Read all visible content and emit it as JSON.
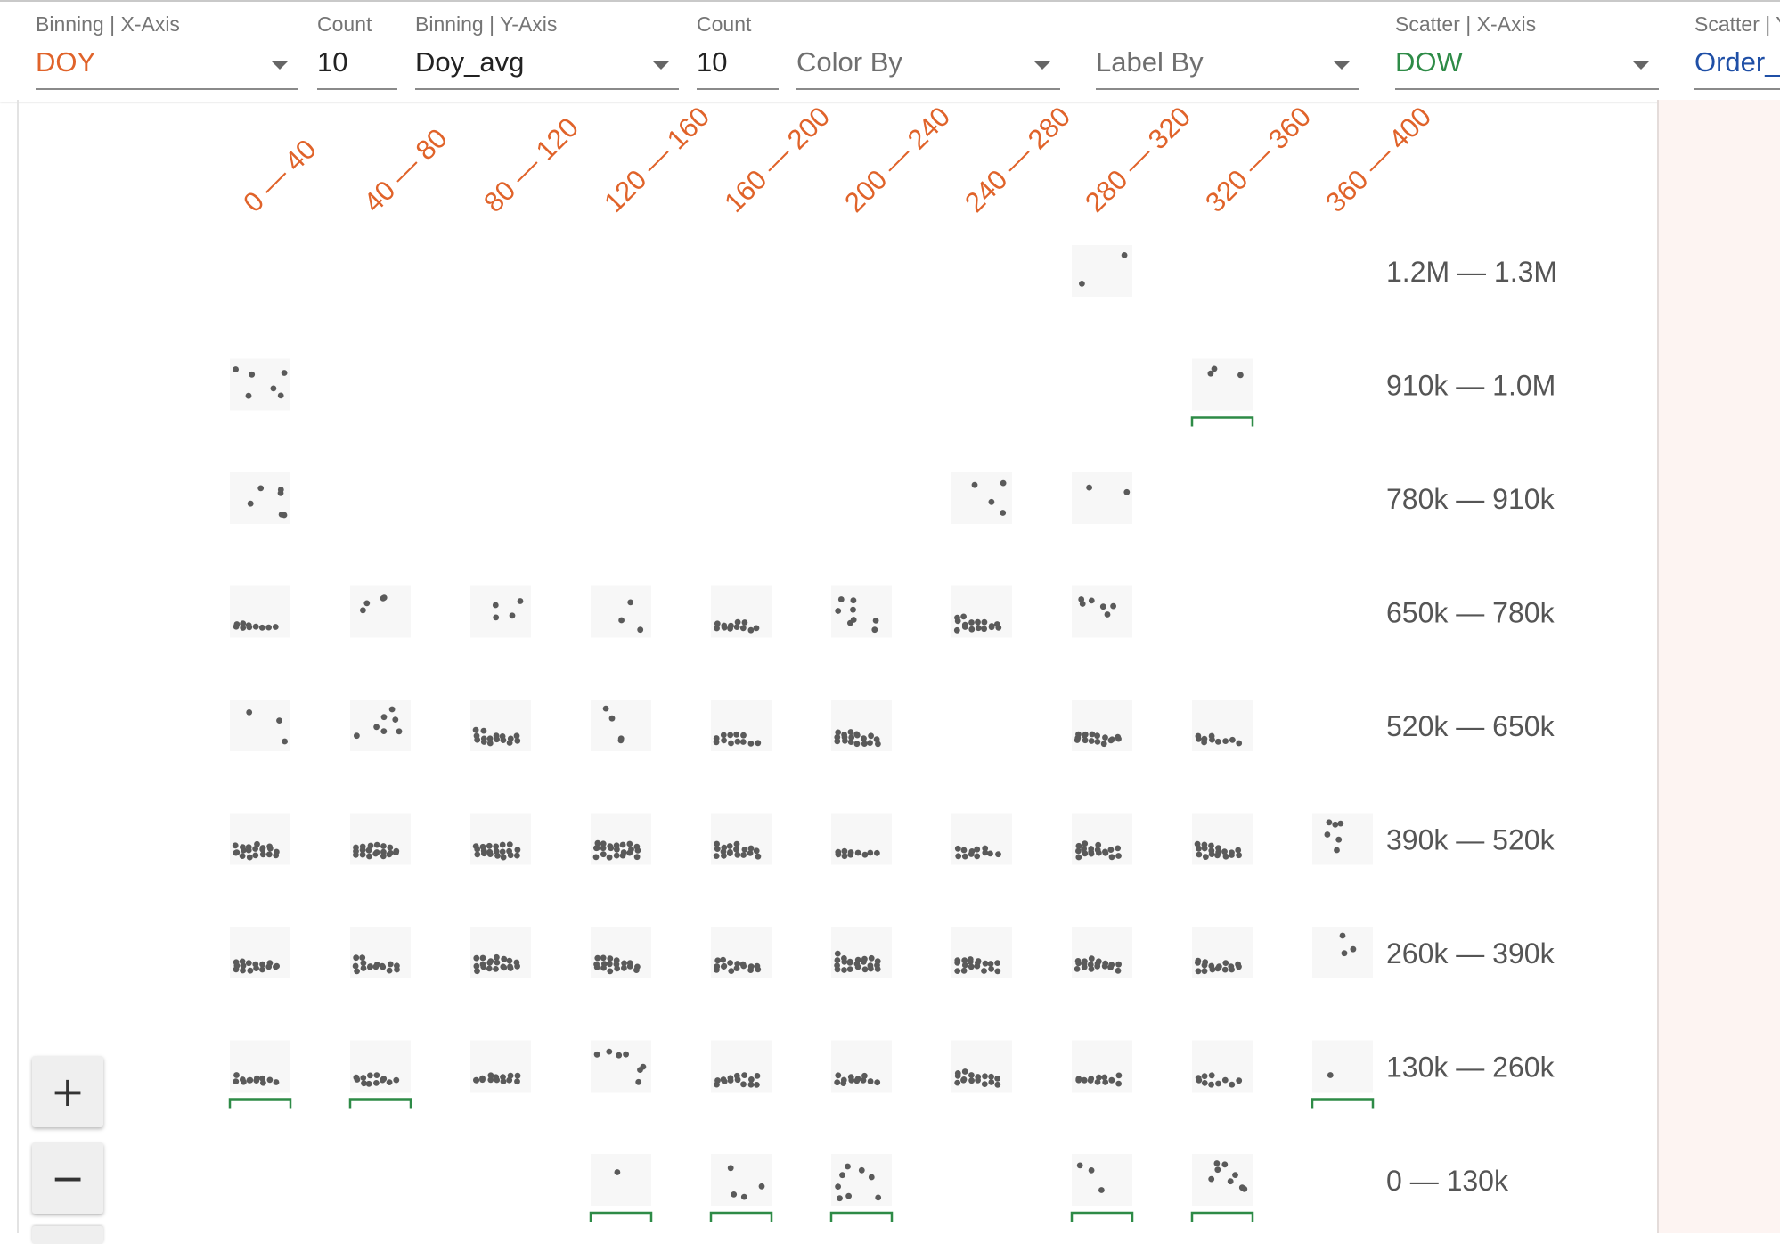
{
  "controls": {
    "binning_x": {
      "label": "Binning | X-Axis",
      "value": "DOY"
    },
    "count_x": {
      "label": "Count",
      "value": "10"
    },
    "binning_y": {
      "label": "Binning | Y-Axis",
      "value": "Doy_avg"
    },
    "count_y": {
      "label": "Count",
      "value": "10"
    },
    "color_by": {
      "placeholder": "Color By"
    },
    "label_by": {
      "placeholder": "Label By"
    },
    "scatter_x": {
      "label": "Scatter | X-Axis",
      "value": "DOW"
    },
    "scatter_y": {
      "label": "Scatter | Y",
      "value": "Order_"
    }
  },
  "colors": {
    "binning_x_value": "#e0632a",
    "scatter_x_value": "#2e8b47",
    "scatter_y_value": "#1f4fa6",
    "column_label": "#e0632a",
    "row_label": "#555555",
    "cell_background": "#f7f7f7",
    "dot": "#5a5a5a",
    "bracket": "#2e8b47"
  },
  "zoom": {
    "in_label": "+",
    "out_label": "−"
  },
  "chart_data": {
    "type": "scatter",
    "columns": [
      "0 — 40",
      "40 — 80",
      "80 — 120",
      "120 — 160",
      "160 — 200",
      "200 — 240",
      "240 — 280",
      "280 — 320",
      "320 — 360",
      "360 — 400"
    ],
    "rows": [
      "1.2M — 1.3M",
      "910k — 1.0M",
      "780k — 910k",
      "650k — 780k",
      "520k — 650k",
      "390k — 520k",
      "260k — 390k",
      "130k — 260k",
      "0 — 130k"
    ],
    "cells": [
      {
        "row": 0,
        "col": 7,
        "density": 2,
        "bracket": false
      },
      {
        "row": 1,
        "col": 0,
        "density": 6,
        "bracket": false
      },
      {
        "row": 1,
        "col": 8,
        "density": 3,
        "bracket": true
      },
      {
        "row": 2,
        "col": 0,
        "density": 6,
        "bracket": false
      },
      {
        "row": 2,
        "col": 6,
        "density": 4,
        "bracket": false
      },
      {
        "row": 2,
        "col": 7,
        "density": 2,
        "bracket": false
      },
      {
        "row": 3,
        "col": 0,
        "density": 10,
        "bracket": false
      },
      {
        "row": 3,
        "col": 1,
        "density": 4,
        "bracket": false
      },
      {
        "row": 3,
        "col": 2,
        "density": 4,
        "bracket": false
      },
      {
        "row": 3,
        "col": 3,
        "density": 3,
        "bracket": false
      },
      {
        "row": 3,
        "col": 4,
        "density": 12,
        "bracket": false
      },
      {
        "row": 3,
        "col": 5,
        "density": 8,
        "bracket": false
      },
      {
        "row": 3,
        "col": 6,
        "density": 16,
        "bracket": false
      },
      {
        "row": 3,
        "col": 7,
        "density": 6,
        "bracket": false
      },
      {
        "row": 4,
        "col": 0,
        "density": 3,
        "bracket": false
      },
      {
        "row": 4,
        "col": 1,
        "density": 7,
        "bracket": false
      },
      {
        "row": 4,
        "col": 2,
        "density": 16,
        "bracket": false
      },
      {
        "row": 4,
        "col": 3,
        "density": 4,
        "bracket": false
      },
      {
        "row": 4,
        "col": 4,
        "density": 12,
        "bracket": false
      },
      {
        "row": 4,
        "col": 5,
        "density": 18,
        "bracket": false
      },
      {
        "row": 4,
        "col": 7,
        "density": 16,
        "bracket": false
      },
      {
        "row": 4,
        "col": 8,
        "density": 10,
        "bracket": false
      },
      {
        "row": 5,
        "col": 0,
        "density": 20,
        "bracket": false
      },
      {
        "row": 5,
        "col": 1,
        "density": 20,
        "bracket": false
      },
      {
        "row": 5,
        "col": 2,
        "density": 20,
        "bracket": false
      },
      {
        "row": 5,
        "col": 3,
        "density": 22,
        "bracket": false
      },
      {
        "row": 5,
        "col": 4,
        "density": 18,
        "bracket": false
      },
      {
        "row": 5,
        "col": 5,
        "density": 10,
        "bracket": false
      },
      {
        "row": 5,
        "col": 6,
        "density": 12,
        "bracket": false
      },
      {
        "row": 5,
        "col": 7,
        "density": 18,
        "bracket": false
      },
      {
        "row": 5,
        "col": 8,
        "density": 18,
        "bracket": false
      },
      {
        "row": 5,
        "col": 9,
        "density": 6,
        "bracket": false
      },
      {
        "row": 6,
        "col": 0,
        "density": 16,
        "bracket": false
      },
      {
        "row": 6,
        "col": 1,
        "density": 16,
        "bracket": false
      },
      {
        "row": 6,
        "col": 2,
        "density": 20,
        "bracket": false
      },
      {
        "row": 6,
        "col": 3,
        "density": 18,
        "bracket": false
      },
      {
        "row": 6,
        "col": 4,
        "density": 16,
        "bracket": false
      },
      {
        "row": 6,
        "col": 5,
        "density": 22,
        "bracket": false
      },
      {
        "row": 6,
        "col": 6,
        "density": 18,
        "bracket": false
      },
      {
        "row": 6,
        "col": 7,
        "density": 18,
        "bracket": false
      },
      {
        "row": 6,
        "col": 8,
        "density": 16,
        "bracket": false
      },
      {
        "row": 6,
        "col": 9,
        "density": 3,
        "bracket": false
      },
      {
        "row": 7,
        "col": 0,
        "density": 12,
        "bracket": true
      },
      {
        "row": 7,
        "col": 1,
        "density": 12,
        "bracket": true
      },
      {
        "row": 7,
        "col": 2,
        "density": 14,
        "bracket": false
      },
      {
        "row": 7,
        "col": 3,
        "density": 7,
        "bracket": false
      },
      {
        "row": 7,
        "col": 4,
        "density": 14,
        "bracket": false
      },
      {
        "row": 7,
        "col": 5,
        "density": 12,
        "bracket": false
      },
      {
        "row": 7,
        "col": 6,
        "density": 16,
        "bracket": false
      },
      {
        "row": 7,
        "col": 7,
        "density": 14,
        "bracket": false
      },
      {
        "row": 7,
        "col": 8,
        "density": 10,
        "bracket": false
      },
      {
        "row": 7,
        "col": 9,
        "density": 1,
        "bracket": true
      },
      {
        "row": 8,
        "col": 3,
        "density": 1,
        "bracket": true
      },
      {
        "row": 8,
        "col": 4,
        "density": 4,
        "bracket": true
      },
      {
        "row": 8,
        "col": 5,
        "density": 8,
        "bracket": true
      },
      {
        "row": 8,
        "col": 7,
        "density": 3,
        "bracket": true
      },
      {
        "row": 8,
        "col": 8,
        "density": 8,
        "bracket": true
      }
    ]
  }
}
